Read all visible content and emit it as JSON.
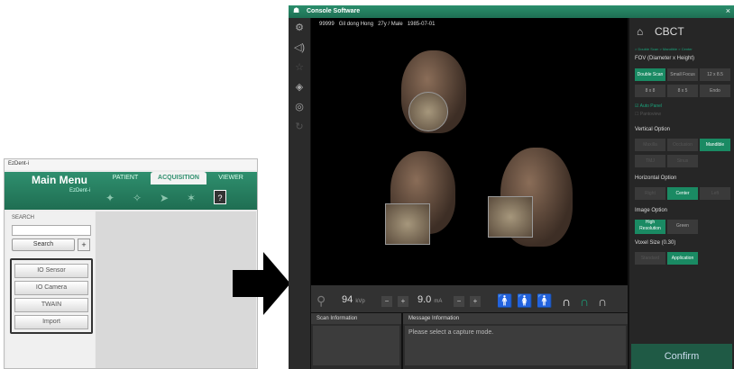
{
  "ezdent": {
    "title": "EzDent-i",
    "main_menu": "Main Menu",
    "brand": "EzDent-i",
    "tabs": [
      "PATIENT",
      "ACQUISITION",
      "VIEWER"
    ],
    "toolbar_icons": [
      "acquire-icon-1",
      "acquire-icon-2",
      "acquire-icon-3",
      "acquire-icon-4"
    ],
    "help": "?",
    "search_label": "SEARCH",
    "search_value": "",
    "search_button": "Search",
    "add_button": "+",
    "acquisition_buttons": [
      "IO Sensor",
      "IO Camera",
      "TWAIN",
      "Import"
    ]
  },
  "console": {
    "title": "Console Software",
    "close": "×",
    "patient": {
      "id": "99999",
      "name": "Gil dong Hong",
      "age_sex": "27y / Male",
      "dob": "1985-07-01"
    },
    "tools": [
      "gear-icon",
      "sound-icon",
      "star-icon",
      "layers-icon",
      "target-icon",
      "refresh-icon"
    ],
    "exposure": {
      "kvp": "94",
      "kvp_unit": "kVp",
      "ma": "9.0",
      "ma_unit": "mA",
      "minus": "−",
      "plus": "+"
    },
    "scan_info_title": "Scan Information",
    "message_title": "Message Information",
    "message": "Please select a capture mode.",
    "right": {
      "mode": "CBCT",
      "breadcrumb": "> Double Scan > Mandible > Center",
      "fov_title": "FOV (Diameter x Height)",
      "fov_options": [
        "Double Scan",
        "Small Focus",
        "12 x 8.5",
        "8 x 8",
        "8 x 5",
        "Endo"
      ],
      "auto_panel": "Auto Panel",
      "pantoview": "Pantoview",
      "vertical_title": "Vertical Option",
      "vertical_options": [
        "Maxilla",
        "Occlusion",
        "Mandible",
        "TMJ",
        "Sinus"
      ],
      "horizontal_title": "Horizontal Option",
      "horizontal_options": [
        "Right",
        "Center",
        "Left"
      ],
      "image_title": "Image Option",
      "image_options": [
        "High Resolution",
        "Green"
      ],
      "voxel_title": "Voxel Size (0.30)",
      "voxel_options": [
        "Standard",
        "Application"
      ],
      "confirm": "Confirm"
    }
  },
  "colors": {
    "accent": "#1a8a63",
    "title_green": "#2a8e6c"
  }
}
